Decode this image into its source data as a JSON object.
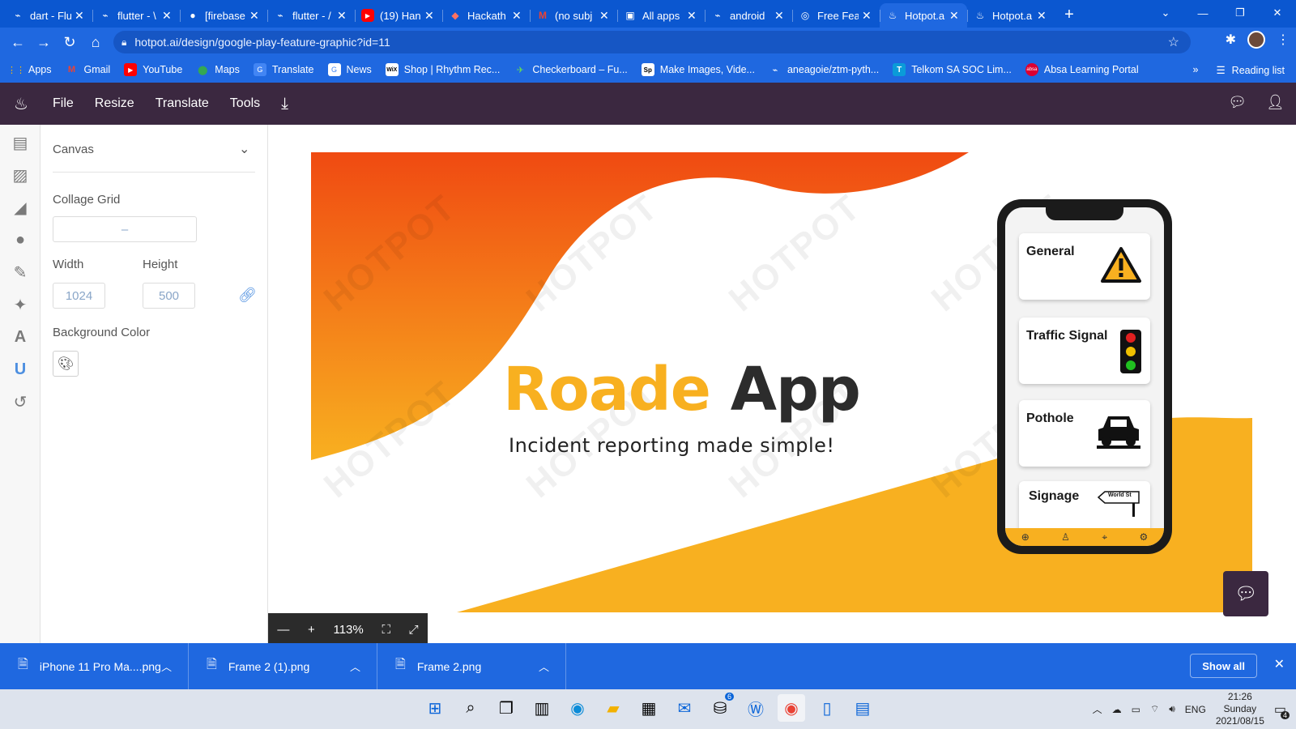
{
  "tabs": [
    {
      "title": "dart - Flu",
      "icon": "file-icon"
    },
    {
      "title": "flutter - \\",
      "icon": "file-icon"
    },
    {
      "title": "[firebase",
      "icon": "github-icon"
    },
    {
      "title": "flutter - /",
      "icon": "file-icon"
    },
    {
      "title": "(19) Han",
      "icon": "youtube-icon"
    },
    {
      "title": "Hackath",
      "icon": "figma-icon"
    },
    {
      "title": "(no subj",
      "icon": "gmail-icon"
    },
    {
      "title": "All apps",
      "icon": "app-icon"
    },
    {
      "title": "android",
      "icon": "file-icon"
    },
    {
      "title": "Free Feat",
      "icon": "compass-icon"
    },
    {
      "title": "Hotpot.a",
      "icon": "hotpot-icon",
      "active": true
    },
    {
      "title": "Hotpot.a",
      "icon": "hotpot-icon"
    }
  ],
  "address": {
    "url": "hotpot.ai/design/google-play-feature-graphic?id=11"
  },
  "bookmarks": [
    {
      "label": "Apps",
      "icon": "apps-grid-icon"
    },
    {
      "label": "Gmail",
      "icon": "gmail-icon"
    },
    {
      "label": "YouTube",
      "icon": "youtube-icon"
    },
    {
      "label": "Maps",
      "icon": "maps-icon"
    },
    {
      "label": "Translate",
      "icon": "translate-icon"
    },
    {
      "label": "News",
      "icon": "news-icon"
    },
    {
      "label": "Shop | Rhythm Rec...",
      "icon": "wix-icon"
    },
    {
      "label": "Checkerboard – Fu...",
      "icon": "bird-icon"
    },
    {
      "label": "Make Images, Vide...",
      "icon": "sp-icon"
    },
    {
      "label": "aneagoie/ztm-pyth...",
      "icon": "file-icon"
    },
    {
      "label": "Telkom SA SOC Lim...",
      "icon": "telkom-icon"
    },
    {
      "label": "Absa Learning Portal",
      "icon": "absa-icon"
    }
  ],
  "bookmarks_right": {
    "reading_list": "Reading list"
  },
  "app_menu": [
    "File",
    "Resize",
    "Translate",
    "Tools"
  ],
  "panel": {
    "section": "Canvas",
    "collage_label": "Collage Grid",
    "collage_value": "–",
    "width_label": "Width",
    "height_label": "Height",
    "width_value": "1024",
    "height_value": "500",
    "bg_label": "Background Color"
  },
  "design": {
    "title_word1": "Roade",
    "title_word2": "App",
    "subtitle": "Incident reporting made simple!",
    "watermark": "HOTPOT",
    "cards": [
      {
        "label": "General"
      },
      {
        "label": "Traffic Signal"
      },
      {
        "label": "Pothole"
      },
      {
        "label": "Signage",
        "sign_text": "World St"
      }
    ],
    "colors": {
      "orange": "#f04a12",
      "yellow": "#f8b020",
      "dark": "#2c2c2c"
    }
  },
  "zoom": {
    "level": "113%"
  },
  "downloads": [
    {
      "name": "iPhone 11 Pro Ma....png"
    },
    {
      "name": "Frame 2 (1).png"
    },
    {
      "name": "Frame 2.png"
    }
  ],
  "downloads_show_all": "Show all",
  "taskbar": {
    "lang": "ENG",
    "time": "21:26",
    "day": "Sunday",
    "date": "2021/08/15",
    "badge": "6",
    "notif": "4"
  }
}
